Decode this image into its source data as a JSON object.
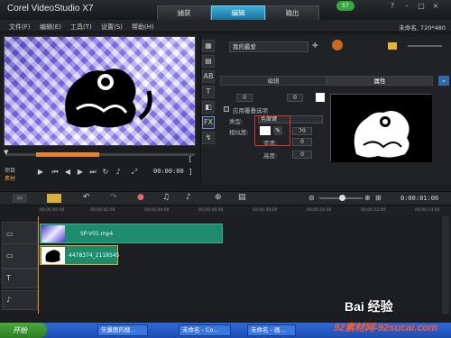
{
  "app": {
    "title": "Corel VideoStudio X7",
    "project_info": "未命名, 720*480"
  },
  "tabs": [
    {
      "label": "捕获"
    },
    {
      "label": "编辑"
    },
    {
      "label": "输出"
    }
  ],
  "badge": "57",
  "menu": [
    {
      "label": "文件(F)"
    },
    {
      "label": "编辑(E)"
    },
    {
      "label": "工具(T)"
    },
    {
      "label": "设置(S)"
    },
    {
      "label": "帮助(H)"
    }
  ],
  "player": {
    "mode_labels": [
      "项目",
      "素材"
    ],
    "timecode": "00:00:00"
  },
  "library": {
    "selected": "我的最爱"
  },
  "options": {
    "subtabs": [
      {
        "label": "编辑"
      },
      {
        "label": "属性"
      }
    ],
    "duration_value": "0",
    "apply_overlay_label": "应用覆叠选项",
    "type_label": "类型:",
    "type_value": "色度键",
    "similarity_label": "相似度:",
    "similarity_value": "70",
    "width_label": "宽度:",
    "width_value": "0",
    "height_label": "高度:",
    "height_value": "0"
  },
  "timeline": {
    "timecode": "0:00:01:00",
    "ruler_ticks": [
      "00:00:00:00",
      "00:00:02:00",
      "00:00:04:00",
      "00:00:06:00",
      "00:00:08:00",
      "00:00:10:00",
      "00:00:12:00",
      "00:00:14:00"
    ],
    "clips": {
      "video": "SP-V01.mp4",
      "overlay": "4478374_2118545"
    }
  },
  "taskbar": {
    "start": "开始",
    "tasks": [
      {
        "label": "矢量图的搜..."
      },
      {
        "label": "未命名 - Co..."
      },
      {
        "label": "未命名 - 画..."
      }
    ]
  },
  "watermark": {
    "baidu": "Bai 经验",
    "site": "92素材网-92sucai.com"
  },
  "colors": {
    "accent": "#1a6f9a",
    "clip": "#1e8b6e",
    "selection": "#e9a22a",
    "taskbar": "#2f6ad8"
  }
}
